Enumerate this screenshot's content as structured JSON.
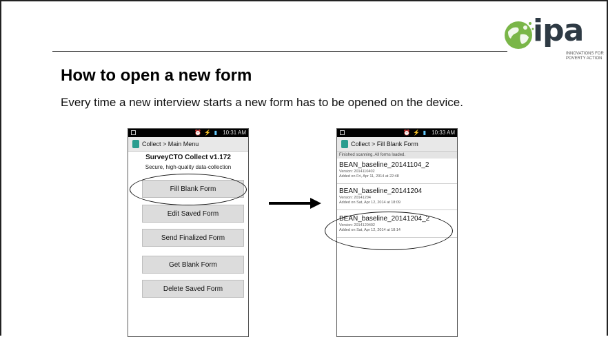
{
  "logo": {
    "text": "ipa",
    "subtitle": "INNOVATIONS FOR POVERTY ACTION",
    "globe_color": "#7ab648"
  },
  "slide": {
    "title": "How to open a new form",
    "subtitle": "Every time a new interview starts a new form has to be opened on the device."
  },
  "left_phone": {
    "time": "10:31 AM",
    "breadcrumb": "Collect > Main Menu",
    "app_name": "SurveyCTO Collect v1.172",
    "tagline": "Secure, high-quality data-collection",
    "buttons": [
      "Fill Blank Form",
      "Edit Saved Form",
      "Send Finalized Form",
      "Get Blank Form",
      "Delete Saved Form"
    ]
  },
  "right_phone": {
    "time": "10:33 AM",
    "breadcrumb": "Collect > Fill Blank Form",
    "scan_status": "Finished scanning. All forms loaded.",
    "forms": [
      {
        "name": "BEAN_baseline_20141104_2",
        "version": "Version: 2014110402",
        "added": "Added on Fri, Apr 11, 2014 at 22:48"
      },
      {
        "name": "BEAN_baseline_20141204",
        "version": "Version: 20141204",
        "added": "Added on Sat, Apr 12, 2014 at 18:09"
      },
      {
        "name": "BEAN_baseline_20141204_2",
        "version": "Version: 2014120402",
        "added": "Added on Sat, Apr 12, 2014 at 18:14"
      }
    ]
  },
  "colors": {
    "accent": "#2a9d8f",
    "button_bg": "#dcdcdc"
  }
}
